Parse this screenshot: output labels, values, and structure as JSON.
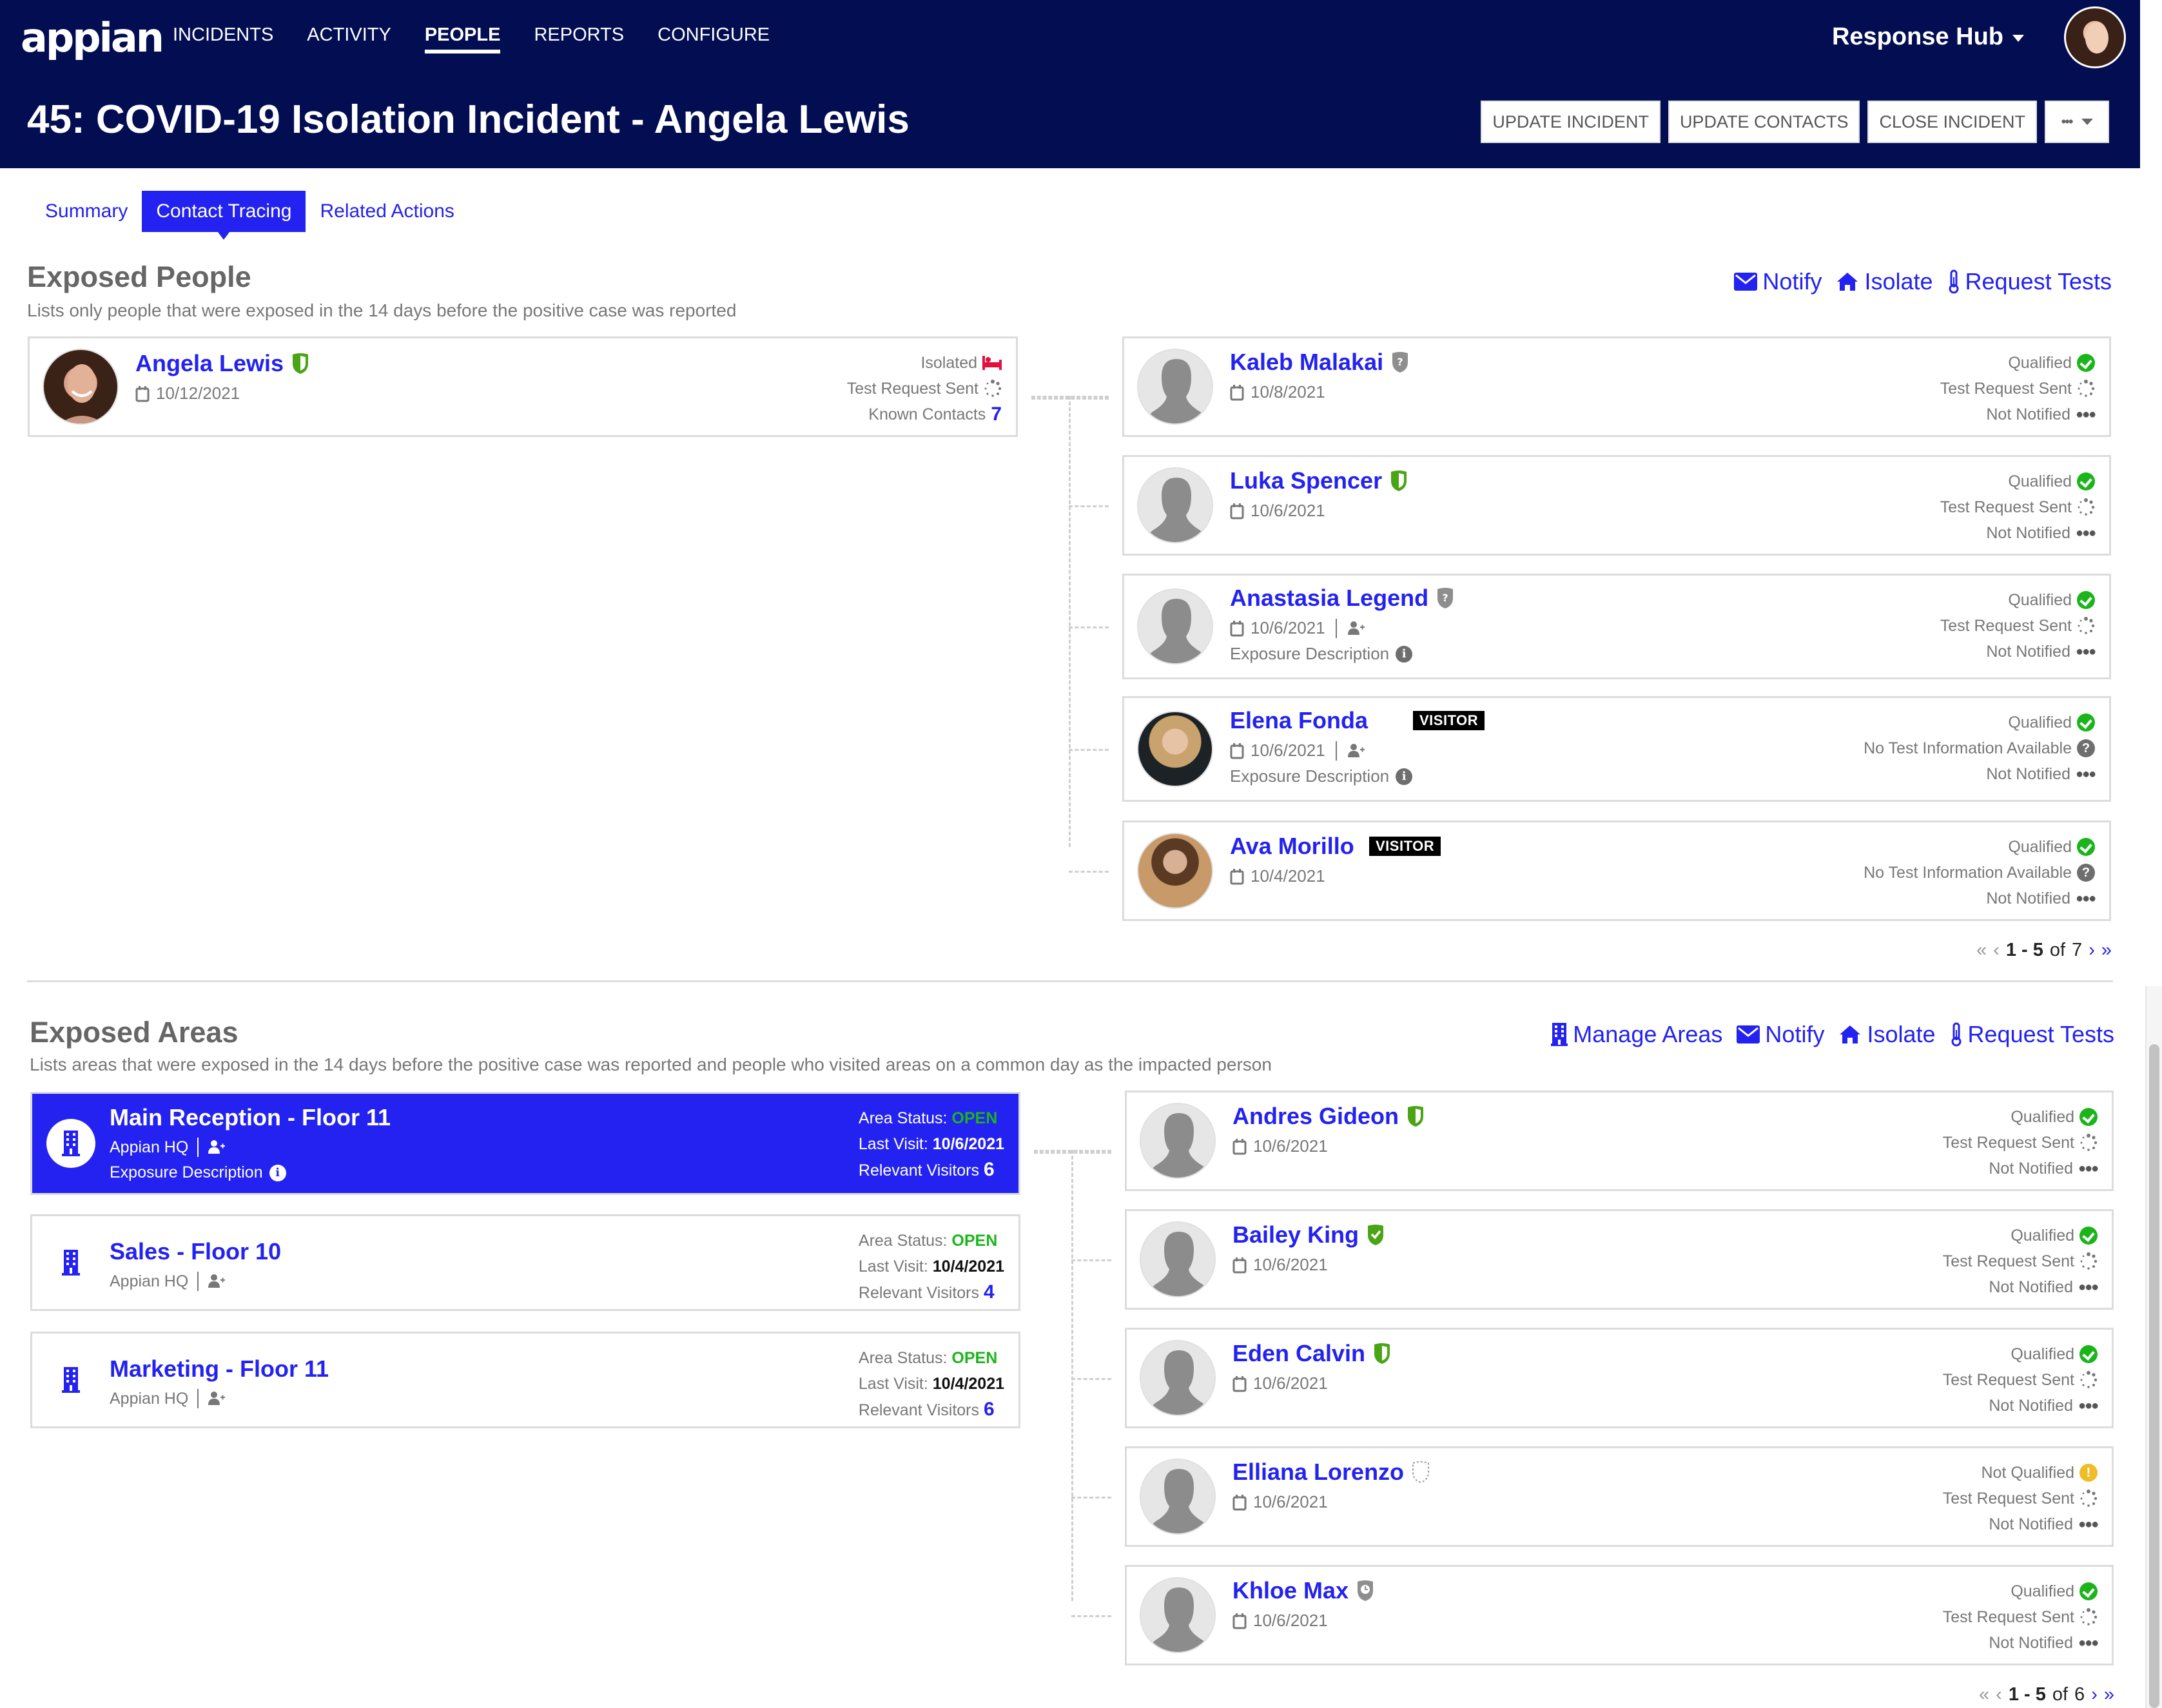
{
  "app": {
    "logo": "appian",
    "nav": [
      "INCIDENTS",
      "ACTIVITY",
      "PEOPLE",
      "REPORTS",
      "CONFIGURE"
    ],
    "active_nav": "PEOPLE",
    "hub_label": "Response Hub"
  },
  "page": {
    "title": "45: COVID-19 Isolation Incident - Angela Lewis",
    "actions": [
      "UPDATE INCIDENT",
      "UPDATE CONTACTS",
      "CLOSE INCIDENT"
    ],
    "more_label": "•••"
  },
  "tabs": [
    {
      "label": "Summary",
      "active": false
    },
    {
      "label": "Contact Tracing",
      "active": true
    },
    {
      "label": "Related Actions",
      "active": false
    }
  ],
  "colors": {
    "header_bg": "#020d52",
    "accent": "#2322f0",
    "qualified": "#1bb51b",
    "warning": "#f0bd29",
    "isolated": "#e0123d",
    "shield_green": "#4aa515"
  },
  "exposed_people": {
    "title": "Exposed People",
    "subtitle": "Lists only people that were exposed in the 14 days before the positive case was reported",
    "actions": [
      {
        "label": "Notify",
        "icon": "envelope-icon"
      },
      {
        "label": "Isolate",
        "icon": "home-icon"
      },
      {
        "label": "Request Tests",
        "icon": "thermometer-icon"
      }
    ],
    "source": {
      "name": "Angela Lewis",
      "shield": "green-half",
      "date": "10/12/2021",
      "status_isolated": "Isolated",
      "status_test": "Test Request Sent",
      "known_contacts_label": "Known Contacts",
      "known_contacts": "7"
    },
    "contacts": [
      {
        "name": "Kaleb Malakai",
        "shield": "gray-question",
        "date": "10/8/2021",
        "visitor": false,
        "exposure": false,
        "qualification": "Qualified",
        "qual_icon": "check",
        "test": "Test Request Sent",
        "test_icon": "spinner",
        "notify": "Not Notified"
      },
      {
        "name": "Luka Spencer",
        "shield": "green-half",
        "date": "10/6/2021",
        "visitor": false,
        "exposure": false,
        "qualification": "Qualified",
        "qual_icon": "check",
        "test": "Test Request Sent",
        "test_icon": "spinner",
        "notify": "Not Notified"
      },
      {
        "name": "Anastasia Legend",
        "shield": "gray-question",
        "date": "10/6/2021",
        "visitor": false,
        "exposure": true,
        "qualification": "Qualified",
        "qual_icon": "check",
        "test": "Test Request Sent",
        "test_icon": "spinner",
        "notify": "Not Notified"
      },
      {
        "name": "Elena Fonda",
        "shield": "none",
        "date": "10/6/2021",
        "visitor": true,
        "exposure": true,
        "qualification": "Qualified",
        "qual_icon": "check",
        "test": "No Test Information Available",
        "test_icon": "question",
        "notify": "Not Notified"
      },
      {
        "name": "Ava Morillo",
        "shield": "none",
        "date": "10/4/2021",
        "visitor": true,
        "exposure": false,
        "qualification": "Qualified",
        "qual_icon": "check",
        "test": "No Test Information Available",
        "test_icon": "question",
        "notify": "Not Notified"
      }
    ],
    "visitor_badge": "VISITOR",
    "exposure_label": "Exposure Description",
    "pagination": {
      "range": "1 - 5",
      "of_label": "of",
      "total": "7"
    }
  },
  "exposed_areas": {
    "title": "Exposed Areas",
    "subtitle": "Lists areas that were exposed in the 14 days before the positive case was reported and people who visited areas on a common day as the impacted person",
    "actions": [
      {
        "label": "Manage Areas",
        "icon": "building-icon"
      },
      {
        "label": "Notify",
        "icon": "envelope-icon"
      },
      {
        "label": "Isolate",
        "icon": "home-icon"
      },
      {
        "label": "Request Tests",
        "icon": "thermometer-icon"
      }
    ],
    "area_status_label": "Area Status:",
    "last_visit_label": "Last Visit:",
    "relevant_visitors_label": "Relevant Visitors",
    "areas": [
      {
        "name": "Main Reception - Floor 11",
        "location": "Appian HQ",
        "exposure": true,
        "status": "OPEN",
        "last_visit": "10/6/2021",
        "visitors": "6",
        "selected": true
      },
      {
        "name": "Sales - Floor 10",
        "location": "Appian HQ",
        "exposure": false,
        "status": "OPEN",
        "last_visit": "10/4/2021",
        "visitors": "4",
        "selected": false
      },
      {
        "name": "Marketing - Floor 11",
        "location": "Appian HQ",
        "exposure": false,
        "status": "OPEN",
        "last_visit": "10/4/2021",
        "visitors": "6",
        "selected": false
      }
    ],
    "visitors": [
      {
        "name": "Andres Gideon",
        "shield": "green-half",
        "date": "10/6/2021",
        "qualification": "Qualified",
        "qual_icon": "check",
        "test": "Test Request Sent",
        "notify": "Not Notified"
      },
      {
        "name": "Bailey King",
        "shield": "green-check",
        "date": "10/6/2021",
        "qualification": "Qualified",
        "qual_icon": "check",
        "test": "Test Request Sent",
        "notify": "Not Notified"
      },
      {
        "name": "Eden Calvin",
        "shield": "green-half",
        "date": "10/6/2021",
        "qualification": "Qualified",
        "qual_icon": "check",
        "test": "Test Request Sent",
        "notify": "Not Notified"
      },
      {
        "name": "Elliana Lorenzo",
        "shield": "dashed-outline",
        "date": "10/6/2021",
        "qualification": "Not Qualified",
        "qual_icon": "warning",
        "test": "Test Request Sent",
        "notify": "Not Notified"
      },
      {
        "name": "Khloe Max",
        "shield": "gray-clock",
        "date": "10/6/2021",
        "qualification": "Qualified",
        "qual_icon": "check",
        "test": "Test Request Sent",
        "notify": "Not Notified"
      }
    ],
    "pagination": {
      "range": "1 - 5",
      "of_label": "of",
      "total": "6"
    }
  }
}
